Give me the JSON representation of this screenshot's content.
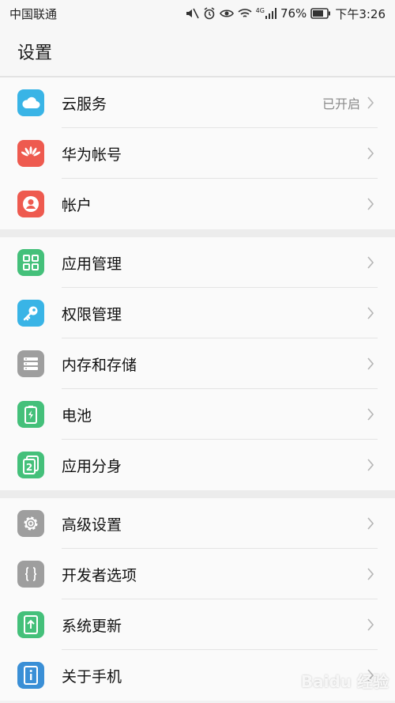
{
  "status": {
    "carrier": "中国联通",
    "network": "4G",
    "battery": "76%",
    "time": "下午3:26"
  },
  "title": "设置",
  "groups": [
    {
      "items": [
        {
          "label": "云服务",
          "value": "已开启",
          "icon": "cloud-icon",
          "color": "#39b4e6"
        },
        {
          "label": "华为帐号",
          "value": "",
          "icon": "huawei-logo-icon",
          "color": "#ee5a4f"
        },
        {
          "label": "帐户",
          "value": "",
          "icon": "user-icon",
          "color": "#ee5a4f"
        }
      ]
    },
    {
      "items": [
        {
          "label": "应用管理",
          "value": "",
          "icon": "grid-apps-icon",
          "color": "#44c07a"
        },
        {
          "label": "权限管理",
          "value": "",
          "icon": "key-icon",
          "color": "#39b4e6"
        },
        {
          "label": "内存和存储",
          "value": "",
          "icon": "storage-icon",
          "color": "#9e9e9e"
        },
        {
          "label": "电池",
          "value": "",
          "icon": "battery-icon",
          "color": "#44c07a"
        },
        {
          "label": "应用分身",
          "value": "",
          "icon": "app-twin-icon",
          "color": "#44c07a"
        }
      ]
    },
    {
      "items": [
        {
          "label": "高级设置",
          "value": "",
          "icon": "gear-icon",
          "color": "#9e9e9e"
        },
        {
          "label": "开发者选项",
          "value": "",
          "icon": "braces-icon",
          "color": "#9e9e9e"
        },
        {
          "label": "系统更新",
          "value": "",
          "icon": "update-icon",
          "color": "#44c07a"
        },
        {
          "label": "关于手机",
          "value": "",
          "icon": "info-phone-icon",
          "color": "#3a8fd6"
        }
      ]
    }
  ],
  "watermark": "Baidu 经验"
}
